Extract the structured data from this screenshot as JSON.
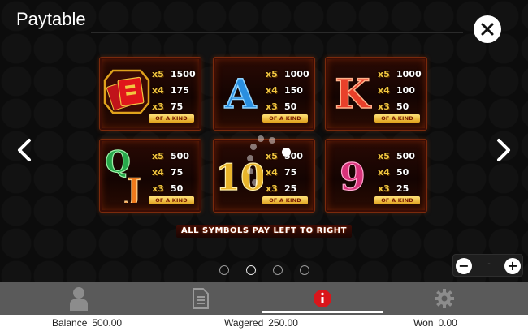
{
  "header": {
    "title": "Paytable"
  },
  "icons": {
    "close": "close-icon",
    "prev": "chevron-left-icon",
    "next": "chevron-right-icon",
    "account": "user-icon",
    "history": "document-icon",
    "info": "info-icon",
    "settings": "gear-icon"
  },
  "paytable": {
    "of_a_kind": "OF A KIND",
    "cards": [
      {
        "symbol": "red-envelope",
        "glyph": "",
        "rows": [
          {
            "mult": "x5",
            "amount": "1500"
          },
          {
            "mult": "x4",
            "amount": "175"
          },
          {
            "mult": "x3",
            "amount": "75"
          }
        ]
      },
      {
        "symbol": "A",
        "glyph": "A",
        "rows": [
          {
            "mult": "x5",
            "amount": "1000"
          },
          {
            "mult": "x4",
            "amount": "150"
          },
          {
            "mult": "x3",
            "amount": "50"
          }
        ]
      },
      {
        "symbol": "K",
        "glyph": "K",
        "rows": [
          {
            "mult": "x5",
            "amount": "1000"
          },
          {
            "mult": "x4",
            "amount": "100"
          },
          {
            "mult": "x3",
            "amount": "50"
          }
        ]
      },
      {
        "symbol": "QJ",
        "glyph": "QJ",
        "rows": [
          {
            "mult": "x5",
            "amount": "500"
          },
          {
            "mult": "x4",
            "amount": "75"
          },
          {
            "mult": "x3",
            "amount": "50"
          }
        ]
      },
      {
        "symbol": "10",
        "glyph": "10",
        "rows": [
          {
            "mult": "x5",
            "amount": "500"
          },
          {
            "mult": "x4",
            "amount": "75"
          },
          {
            "mult": "x3",
            "amount": "25"
          }
        ]
      },
      {
        "symbol": "9",
        "glyph": "9",
        "rows": [
          {
            "mult": "x5",
            "amount": "500"
          },
          {
            "mult": "x4",
            "amount": "50"
          },
          {
            "mult": "x3",
            "amount": "25"
          }
        ]
      }
    ],
    "note": "ALL SYMBOLS PAY LEFT TO RIGHT"
  },
  "pager": {
    "pages": 4,
    "current": 2
  },
  "zoom": {
    "minus": "−",
    "plus": "+",
    "level": "-"
  },
  "status": {
    "balance_label": "Balance",
    "balance_value": "500.00",
    "wagered_label": "Wagered",
    "wagered_value": "250.00",
    "won_label": "Won",
    "won_value": "0.00"
  },
  "colors": {
    "accent_red": "#d9161b",
    "gold": "#f2c640",
    "card_glow": "#c4410a"
  }
}
